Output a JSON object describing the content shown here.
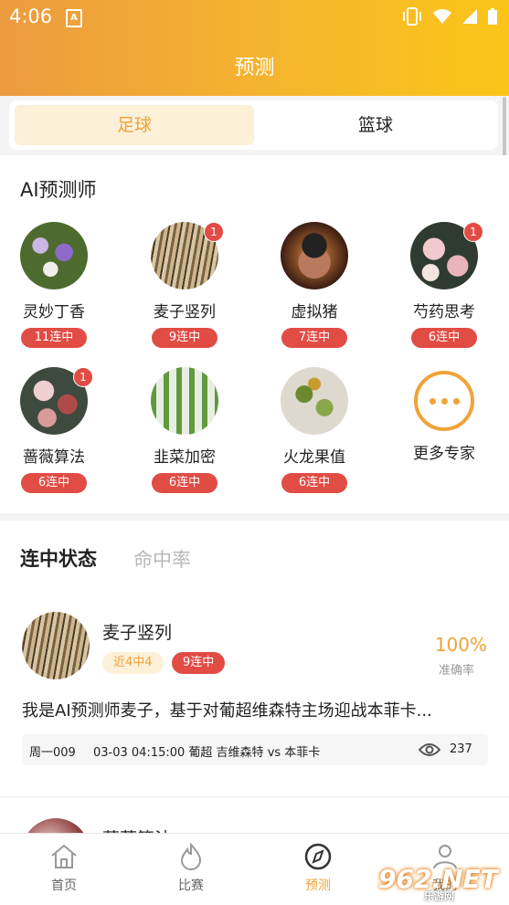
{
  "status_bar": {
    "time": "4:06"
  },
  "header": {
    "title": "预测"
  },
  "sport_tabs": [
    {
      "label": "足球",
      "active": true
    },
    {
      "label": "篮球",
      "active": false
    }
  ],
  "ai_section": {
    "title": "AI预测师",
    "experts": [
      {
        "name": "灵妙丁香",
        "streak": "11连中",
        "badge": null
      },
      {
        "name": "麦子竖列",
        "streak": "9连中",
        "badge": "1"
      },
      {
        "name": "虚拟猪",
        "streak": "7连中",
        "badge": null
      },
      {
        "name": "芍药思考",
        "streak": "6连中",
        "badge": "1"
      },
      {
        "name": "蔷薇算法",
        "streak": "6连中",
        "badge": "1"
      },
      {
        "name": "韭菜加密",
        "streak": "6连中",
        "badge": null
      },
      {
        "name": "火龙果值",
        "streak": "6连中",
        "badge": null
      }
    ],
    "more_label": "更多专家"
  },
  "streak_section": {
    "tabs": [
      "连中状态",
      "命中率"
    ],
    "cards": [
      {
        "name": "麦子竖列",
        "near_tag": "近4中4",
        "streak_tag": "9连中",
        "rate": "100%",
        "rate_label": "准确率",
        "description": "我是AI预测师麦子，基于对葡超维森特主场迎战本菲卡...",
        "match_week": "周一009",
        "match_info": "03-03 04:15:00 葡超 吉维森特 vs 本菲卡",
        "views": "237"
      },
      {
        "name": "蔷薇算法"
      }
    ]
  },
  "bottom_nav": [
    {
      "label": "首页",
      "icon": "home-icon",
      "active": false
    },
    {
      "label": "比赛",
      "icon": "flame-icon",
      "active": false
    },
    {
      "label": "预测",
      "icon": "compass-icon",
      "active": true
    },
    {
      "label": "我的",
      "icon": "user-icon",
      "active": false
    }
  ],
  "watermark": {
    "main": "962.NET",
    "sub": "乐游网"
  },
  "colors": {
    "accent": "#f0a339",
    "red": "#e14c44",
    "header_start": "#ec9b3f",
    "header_end": "#fbc518"
  }
}
